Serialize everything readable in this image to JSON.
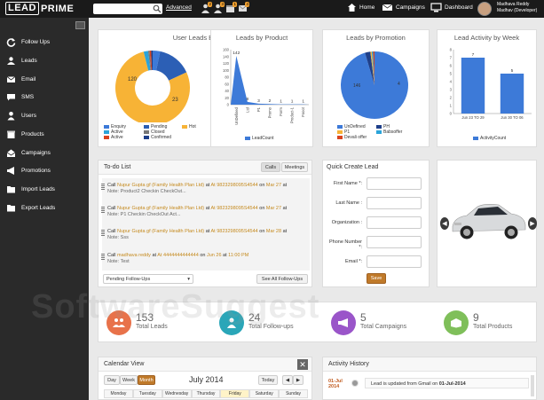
{
  "brand": {
    "box": "LEAD",
    "rest": "PRIME"
  },
  "search": {
    "value": ""
  },
  "header": {
    "advanced": "Advanced",
    "badges": [
      "2",
      "3",
      "1",
      "4"
    ],
    "home": "Home",
    "campaigns": "Campaigns",
    "dashboard": "Dashboard",
    "user_name": "Madhava Reddy",
    "user_role": "Madhav (Developer)"
  },
  "sidebar": {
    "items": [
      {
        "label": "Follow Ups",
        "icon": "refresh-icon"
      },
      {
        "label": "Leads",
        "icon": "users-icon"
      },
      {
        "label": "Email",
        "icon": "envelope-icon"
      },
      {
        "label": "SMS",
        "icon": "chat-icon"
      },
      {
        "label": "Users",
        "icon": "user-icon"
      },
      {
        "label": "Products",
        "icon": "box-icon"
      },
      {
        "label": "Campaigns",
        "icon": "envelope-open-icon"
      },
      {
        "label": "Promotions",
        "icon": "megaphone-icon"
      },
      {
        "label": "Import Leads",
        "icon": "folder-import-icon"
      },
      {
        "label": "Export Leads",
        "icon": "folder-export-icon"
      }
    ]
  },
  "widgets": {
    "status": {
      "title": "User Leads By Status",
      "labels": [
        "120",
        "23"
      ],
      "legend": [
        "Enquiry",
        "Pending",
        "Hot",
        "Active",
        "Closed",
        "Active",
        "Confirmed"
      ]
    },
    "product": {
      "title": "Leads by Product",
      "legend": "LeadCount"
    },
    "promotion": {
      "title": "Leads by Promotion",
      "labels": [
        "146",
        "4"
      ],
      "legend": [
        "UnDefined",
        "PH",
        "P1",
        "Babsoffer",
        "Devali offer"
      ]
    },
    "week": {
      "title": "Lead Activity by Week",
      "legend": "ActivityCount"
    }
  },
  "chart_data": [
    {
      "type": "pie",
      "title": "User Leads By Status",
      "categories": [
        "Enquiry",
        "Pending",
        "Hot",
        "Active",
        "Closed",
        "Active",
        "Confirmed"
      ],
      "values": [
        5,
        23,
        120,
        3,
        1,
        1,
        1
      ]
    },
    {
      "type": "bar",
      "title": "Leads by Product",
      "categories": [
        "UnDefined",
        "Ltd",
        "P1",
        "Promo",
        "Form",
        "Product-1",
        "Fooot"
      ],
      "values": [
        142,
        8,
        3,
        2,
        1,
        1,
        1
      ],
      "ylim": [
        0,
        160
      ],
      "yticks": [
        "160",
        "140",
        "120",
        "100",
        "80",
        "60",
        "40",
        "20",
        "0"
      ],
      "legend": "LeadCount"
    },
    {
      "type": "pie",
      "title": "Leads by Promotion",
      "categories": [
        "UnDefined",
        "PH",
        "P1",
        "Babsoffer",
        "Devali offer"
      ],
      "values": [
        146,
        4,
        1,
        1,
        1
      ]
    },
    {
      "type": "bar",
      "title": "Lead Activity by Week",
      "categories": [
        "Jun 23 TO 29",
        "Jun 30 TO 06"
      ],
      "values": [
        7,
        5
      ],
      "ylim": [
        0,
        8
      ],
      "yticks": [
        "8",
        "7",
        "6",
        "5",
        "4",
        "3",
        "2",
        "1",
        "0"
      ],
      "legend": "ActivityCount"
    }
  ],
  "todo": {
    "title": "To-do List",
    "tabs": [
      "Calls",
      "Meetings"
    ],
    "items": [
      {
        "call": "Call",
        "name": "Nupur Gupta gf (Family Health Plan Ltd)",
        "at1": "at",
        "number": "At 9823298095S4544",
        "on": "on",
        "date": "Mar 27",
        "at2": "at",
        "note": "Note: Product2 Checkin CheckOut..."
      },
      {
        "call": "Call",
        "name": "Nupur Gupta gf (Family Health Plan Ltd)",
        "at1": "at",
        "number": "At 9823298095S4544",
        "on": "on",
        "date": "Mar 27",
        "at2": "at",
        "note": "Note: P1 Checkin CheckOut Act..."
      },
      {
        "call": "Call",
        "name": "Nupur Gupta gf (Family Health Plan Ltd)",
        "at1": "at",
        "number": "At 9823298095S4544",
        "on": "on",
        "date": "Mar 28",
        "at2": "at",
        "note": "Note: Sss"
      },
      {
        "call": "Call",
        "name": "madhava reddy",
        "at1": "at",
        "number": "At 4444444444444",
        "on": "on",
        "date": "Jun 26",
        "at2": "at",
        "time": "11:00 PM",
        "note": "Note: Test"
      }
    ],
    "select": "Pending Follow-Ups",
    "see_all": "See All Follow-Ups"
  },
  "quick_lead": {
    "title": "Quick Create Lead",
    "fields": [
      "First Name *:",
      "Last Name :",
      "Organization :",
      "Phone Number *:",
      "Email *:"
    ],
    "save": "Save"
  },
  "stats": [
    {
      "num": "153",
      "label": "Total Leads",
      "color": "#e8724a"
    },
    {
      "num": "24",
      "label": "Total Follow-ups",
      "color": "#2aa6b8"
    },
    {
      "num": "5",
      "label": "Total Campaigns",
      "color": "#9a55c9"
    },
    {
      "num": "9",
      "label": "Total Products",
      "color": "#7fbf5a"
    }
  ],
  "calendar": {
    "title": "Calendar View",
    "views": [
      "Day",
      "Week",
      "Month"
    ],
    "month": "July 2014",
    "today": "Today",
    "days": [
      "Monday",
      "Tuesday",
      "Wednesday",
      "Thursday",
      "Friday",
      "Saturday",
      "Sunday"
    ]
  },
  "activity": {
    "title": "Activity History",
    "date": "01-Jul\n2014",
    "text_a": "Lead is updated from Gmail on ",
    "text_b": "01-Jul-2014"
  },
  "watermark": "SoftwareSuggest"
}
